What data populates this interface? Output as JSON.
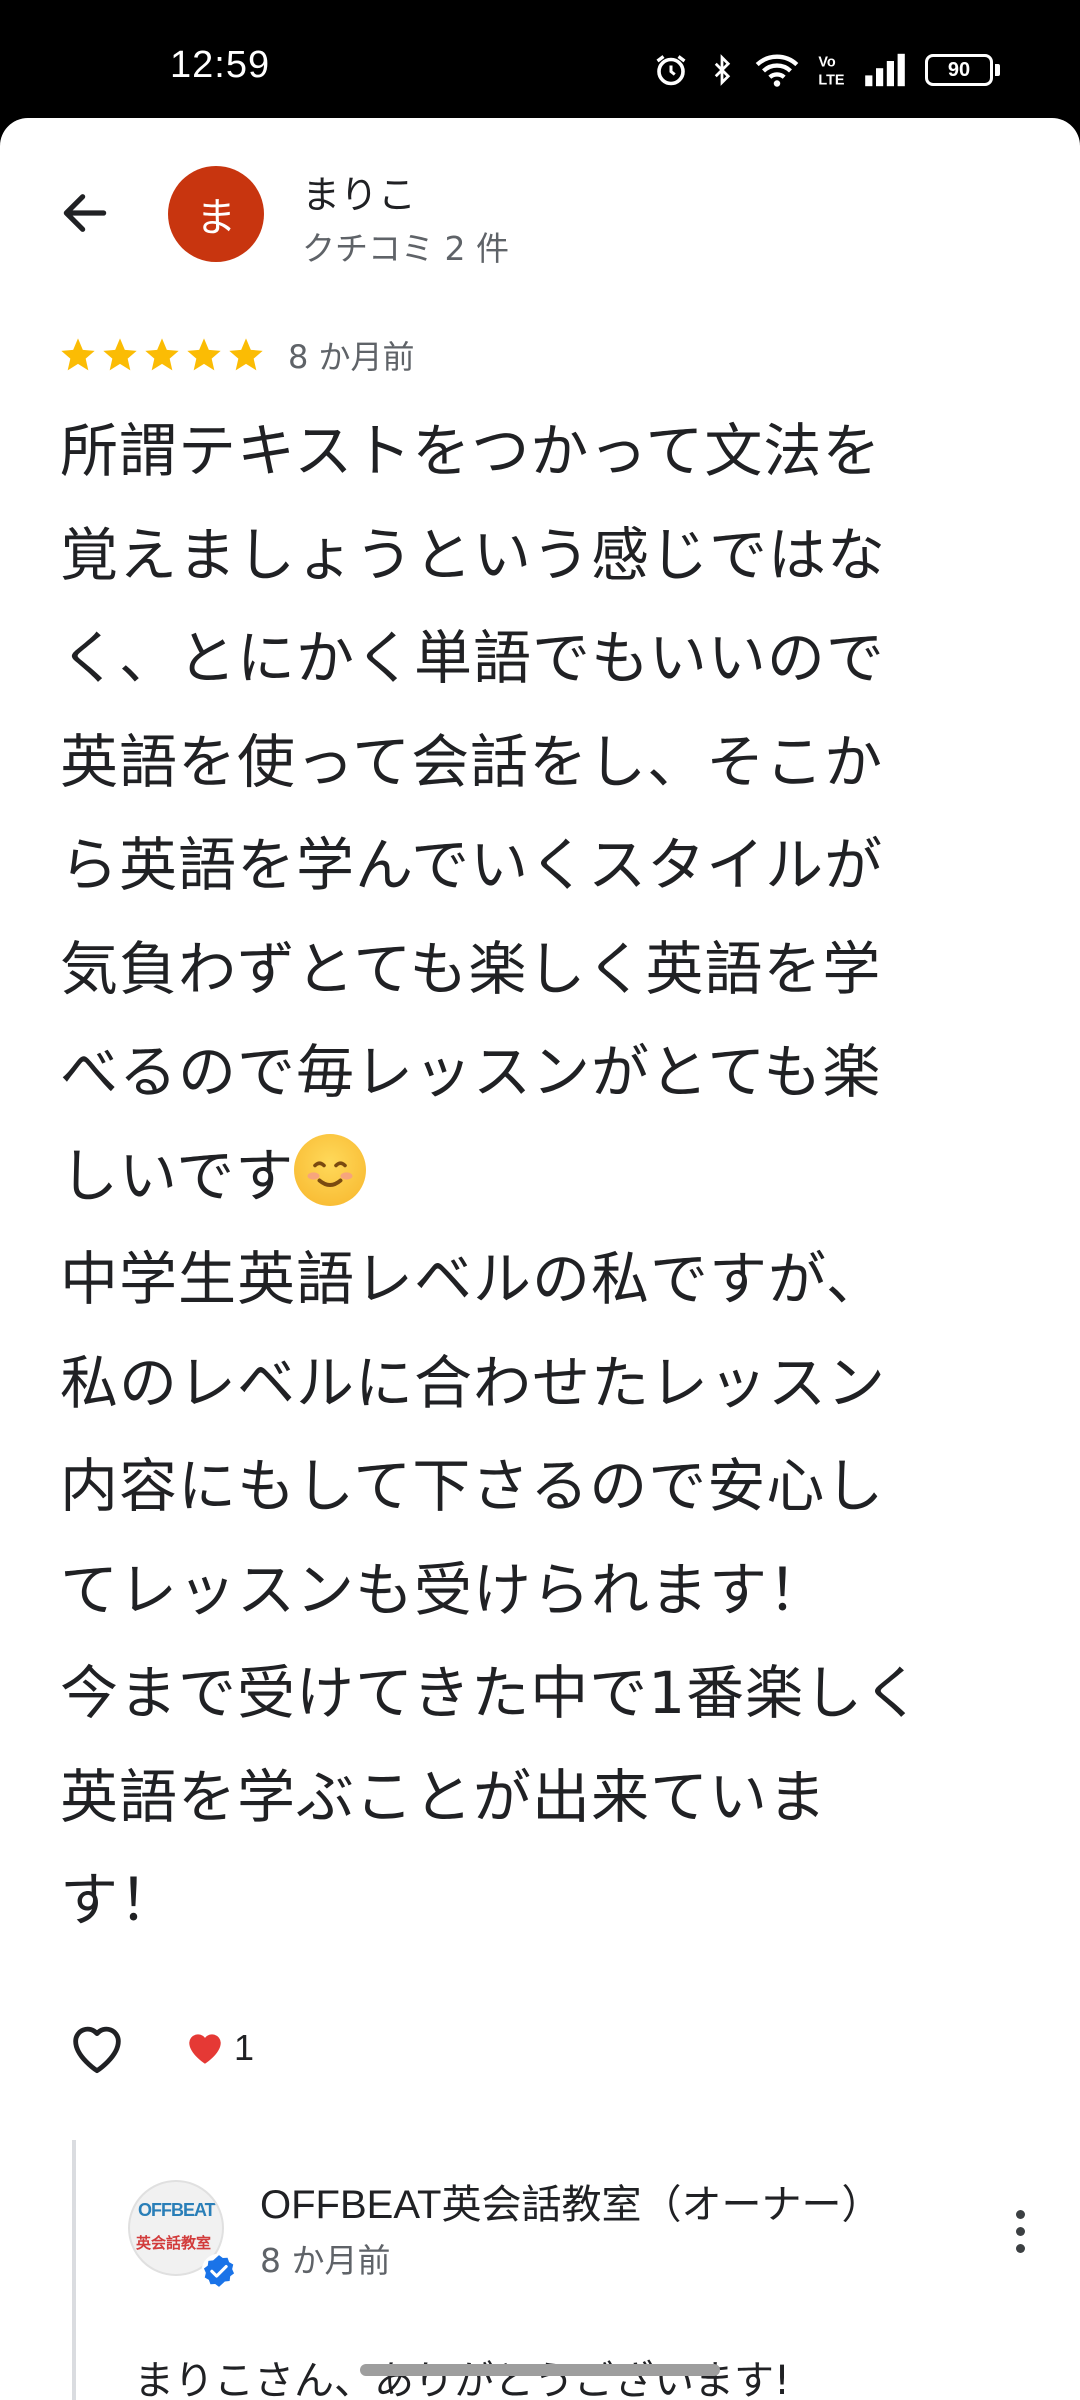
{
  "status": {
    "time": "12:59",
    "battery": "90",
    "icons": [
      "alarm-icon",
      "bluetooth-icon",
      "wifi-icon",
      "volte-icon",
      "signal-icon"
    ]
  },
  "reviewer": {
    "avatar_initial": "ま",
    "avatar_color": "#C8350F",
    "name": "まりこ",
    "review_count": "クチコミ 2 件"
  },
  "review": {
    "rating": 5,
    "date": "8 か月前",
    "text_part1": "所謂テキストをつかって文法を\n覚えましょうという感じではな\nく、とにかく単語でもいいので\n英語を使って会話をし、そこか\nら英語を学んでいくスタイルが\n気負わずとても楽しく英語を学\nべるので毎レッスンがとても楽\nしいです",
    "text_part2": "\n中学生英語レベルの私ですが、\n私のレベルに合わせたレッスン\n内容にもして下さるので安心し\nてレッスンも受けられます！\n今まで受けてきた中で1番楽しく\n英語を学ぶことが出来ていま\nす！",
    "reaction_count": "1"
  },
  "owner_reply": {
    "logo_top": "OFFBEAT",
    "logo_bottom": "英会話教室",
    "name": "OFFBEAT英会話教室（オーナー）",
    "date": "8 か月前",
    "text": "まりこさん、ありがとうございます!"
  },
  "colors": {
    "star": "#FBBC04",
    "heart": "#E53935",
    "verified": "#1A73E8"
  }
}
